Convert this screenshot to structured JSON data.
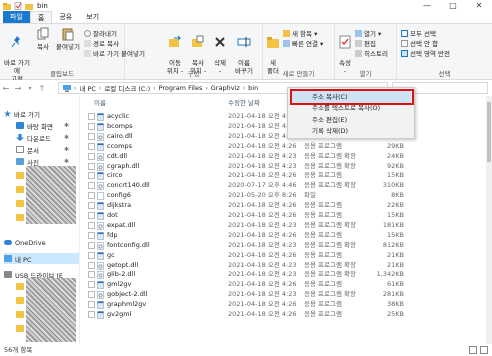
{
  "window": {
    "title": "bin",
    "controls": [
      "—",
      "□",
      "✕"
    ]
  },
  "tabs": [
    {
      "label": "파일"
    },
    {
      "label": "홈"
    },
    {
      "label": "공유"
    },
    {
      "label": "보기"
    }
  ],
  "ribbon": {
    "clipboard": {
      "pin_label": "바로 가기에\n고정",
      "copy_label": "복사",
      "paste_label": "붙여넣기",
      "cut_label": "잘라내기",
      "copy_path_label": "경로 복사",
      "paste_shortcut_label": "바로 가기 붙여넣기",
      "group_label": "클립보드"
    },
    "organize": {
      "move_label": "이동\n위치 -",
      "copy_to_label": "복사\n위치 -",
      "delete_label": "삭제\n-",
      "rename_label": "이름\n바꾸기",
      "group_label": "구성"
    },
    "new": {
      "new_folder_label": "새\n폴더",
      "new_item_label": "새 항목 ▾",
      "easy_access_label": "빠른 연결 ▾",
      "group_label": "새로 만들기"
    },
    "open": {
      "properties_label": "속성\n-",
      "open_label": "열기 ▾",
      "edit_label": "편집",
      "history_label": "히스토리",
      "group_label": "열기"
    },
    "select": {
      "select_all_label": "모두 선택",
      "select_none_label": "선택 안 함",
      "invert_label": "선택 영역 반전",
      "group_label": "선택"
    }
  },
  "address": {
    "crumbs": [
      "내 PC",
      "로컬 디스크 (C:)",
      "Program Files",
      "Graphviz",
      "bin"
    ]
  },
  "sidebar": {
    "items": [
      {
        "label": "바로 가기"
      },
      {
        "label": "바탕 화면"
      },
      {
        "label": "다운로드"
      },
      {
        "label": "문서"
      },
      {
        "label": "사진"
      },
      {
        "label": "OneDrive"
      },
      {
        "label": "내 PC"
      },
      {
        "label": "USB 드라이브 (E"
      }
    ]
  },
  "columns": {
    "name": "이름",
    "date": "수정한 날짜",
    "type": "유형",
    "size": "크기"
  },
  "files": [
    {
      "name": "acyclic",
      "date": "2021-04-18 오전 4:26",
      "type": "응용 프로그램",
      "size": ""
    },
    {
      "name": "bcomps",
      "date": "2021-04-18 오전 4:26",
      "type": "응용 프로그램",
      "size": ""
    },
    {
      "name": "cairo.dll",
      "date": "2021-04-18 오전 4:23",
      "type": "응용 프로그램 확장",
      "size": "1,472KB"
    },
    {
      "name": "ccomps",
      "date": "2021-04-18 오전 4:26",
      "type": "응용 프로그램",
      "size": "29KB"
    },
    {
      "name": "cdt.dll",
      "date": "2021-04-18 오전 4:23",
      "type": "응용 프로그램 확장",
      "size": "24KB"
    },
    {
      "name": "cgraph.dll",
      "date": "2021-04-18 오전 4:23",
      "type": "응용 프로그램 확장",
      "size": "92KB"
    },
    {
      "name": "circo",
      "date": "2021-04-18 오전 4:26",
      "type": "응용 프로그램",
      "size": "15KB"
    },
    {
      "name": "concrt140.dll",
      "date": "2020-07-17 오후 4:46",
      "type": "응용 프로그램 확장",
      "size": "310KB"
    },
    {
      "name": "config6",
      "date": "2021-05-20 오후 8:26",
      "type": "파일",
      "size": "8KB"
    },
    {
      "name": "dijkstra",
      "date": "2021-04-18 오전 4:26",
      "type": "응용 프로그램",
      "size": "22KB"
    },
    {
      "name": "dot",
      "date": "2021-04-18 오전 4:26",
      "type": "응용 프로그램",
      "size": "15KB"
    },
    {
      "name": "expat.dll",
      "date": "2021-04-18 오전 4:23",
      "type": "응용 프로그램 확장",
      "size": "181KB"
    },
    {
      "name": "fdp",
      "date": "2021-04-18 오전 4:26",
      "type": "응용 프로그램",
      "size": "15KB"
    },
    {
      "name": "fontconfig.dll",
      "date": "2021-04-18 오전 4:23",
      "type": "응용 프로그램 확장",
      "size": "812KB"
    },
    {
      "name": "gc",
      "date": "2021-04-18 오전 4:26",
      "type": "응용 프로그램",
      "size": "21KB"
    },
    {
      "name": "getopt.dll",
      "date": "2021-04-18 오전 4:23",
      "type": "응용 프로그램 확장",
      "size": "21KB"
    },
    {
      "name": "glib-2.dll",
      "date": "2021-04-18 오전 4:23",
      "type": "응용 프로그램 확장",
      "size": "1,342KB"
    },
    {
      "name": "gml2gv",
      "date": "2021-04-18 오전 4:26",
      "type": "응용 프로그램",
      "size": "61KB"
    },
    {
      "name": "gobject-2.dll",
      "date": "2021-04-18 오전 4:23",
      "type": "응용 프로그램 확장",
      "size": "281KB"
    },
    {
      "name": "graphml2gv",
      "date": "2021-04-18 오전 4:26",
      "type": "응용 프로그램",
      "size": "38KB"
    },
    {
      "name": "gv2gml",
      "date": "2021-04-18 오전 4:26",
      "type": "응용 프로그램",
      "size": "25KB"
    }
  ],
  "context_menu": {
    "items": [
      {
        "label": "주소 복사(C)"
      },
      {
        "label": "주소를 텍스트로 복사(O)"
      },
      {
        "label": "주소 편집(E)"
      },
      {
        "label": "기록 삭제(D)"
      }
    ]
  },
  "status": {
    "count": "56개 항목"
  },
  "colors": {
    "accent": "#1979ca",
    "highlight_border": "#e01010",
    "selection": "#cfe3f6"
  }
}
